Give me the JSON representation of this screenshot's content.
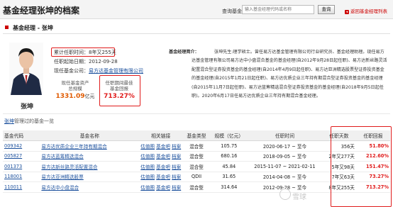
{
  "header": {
    "title": "基金经理张坤的档案",
    "query_label": "查询基金：",
    "search_placeholder": "输入基金经理代码或名称",
    "search_button": "查询",
    "back_link": "返回基金经理列表"
  },
  "profile_section_title": "基金经理 - 张坤",
  "manager": {
    "name": "张坤",
    "tenure_label": "累计任职时间：",
    "tenure_value": "8年又255天",
    "start_label": "任职起始日期：",
    "start_value": "2012-09-28",
    "company_label": "现任基金公司：",
    "company_value": "易方达基金管理有限公司",
    "assets_label_1": "现任基金资产",
    "assets_label_2": "总规模",
    "assets_value": "1331.09",
    "assets_unit": "亿元",
    "best_label_1": "任职期间最佳",
    "best_label_2": "基金回报",
    "best_value": "713.27%"
  },
  "bio": {
    "label": "基金经理简介：",
    "text": "张坤先生:理学硕士。曾任易方达基金管理有限公司行业研究员、基金经理助理。现任易方达基金管理有限公司易方达中小盘混合基金的基金经理(自2012年9月28日起任职)、易方达新丝路灵活配置混合型证券投资基金的基金经理(自2014年4月9日起任职)、易方达亚洲精选股票型证券投资基金的基金经理(自2015年1月21日起任职)、易方达优质企业三年持有期混合型证券投资基金的基金经理(自2015年11月7日起任职)、易方达蓝筹精选混合型证券投资基金的基金经理(自2018年9月5日起任职)。2020年6月17日任易方达优质企业三年持有期混合基金经理。"
  },
  "funds_section": {
    "manager_link": "张坤",
    "title_suffix": "管理过的基金一览"
  },
  "table": {
    "headers": [
      "基金代码",
      "基金名称",
      "相关链接",
      "基金类型",
      "规模（亿元）",
      "任职时间",
      "任职天数",
      "任职回报"
    ],
    "link_labels": [
      "估值图",
      "基金吧",
      "档案"
    ],
    "rows": [
      {
        "code": "009342",
        "name": "易方达优质企业三年持有期混合",
        "type": "混合型",
        "size": "105.75",
        "period": "2020-06-17 ~ 至今",
        "days": "356天",
        "ret": "51.80%"
      },
      {
        "code": "005827",
        "name": "易方达蓝筹精选混合",
        "type": "混合型",
        "size": "680.16",
        "period": "2018-09-05 ~ 至今",
        "days": "2年又277天",
        "ret": "212.60%"
      },
      {
        "code": "001373",
        "name": "易方达新丝路灵活配置混合",
        "type": "混合型",
        "size": "45.84",
        "period": "2015-11-07 ~ 2021-02-11",
        "days": "5年又98天",
        "ret": "151.47%"
      },
      {
        "code": "118001",
        "name": "易方达亚洲精选股票",
        "type": "QDII",
        "size": "31.65",
        "period": "2014-04-08 ~ 至今",
        "days": "7年又63天",
        "ret": "73.27%"
      },
      {
        "code": "110011",
        "name": "易方达中小盘混合",
        "type": "混合型",
        "size": "314.64",
        "period": "2012-09-28 ~ 至今",
        "days": "8年又255天",
        "ret": "713.27%"
      }
    ]
  },
  "watermark": "雪球",
  "colors": {
    "accent_red": "#e01b1b",
    "orange": "#e05a00",
    "link_blue": "#1a4f9c"
  }
}
